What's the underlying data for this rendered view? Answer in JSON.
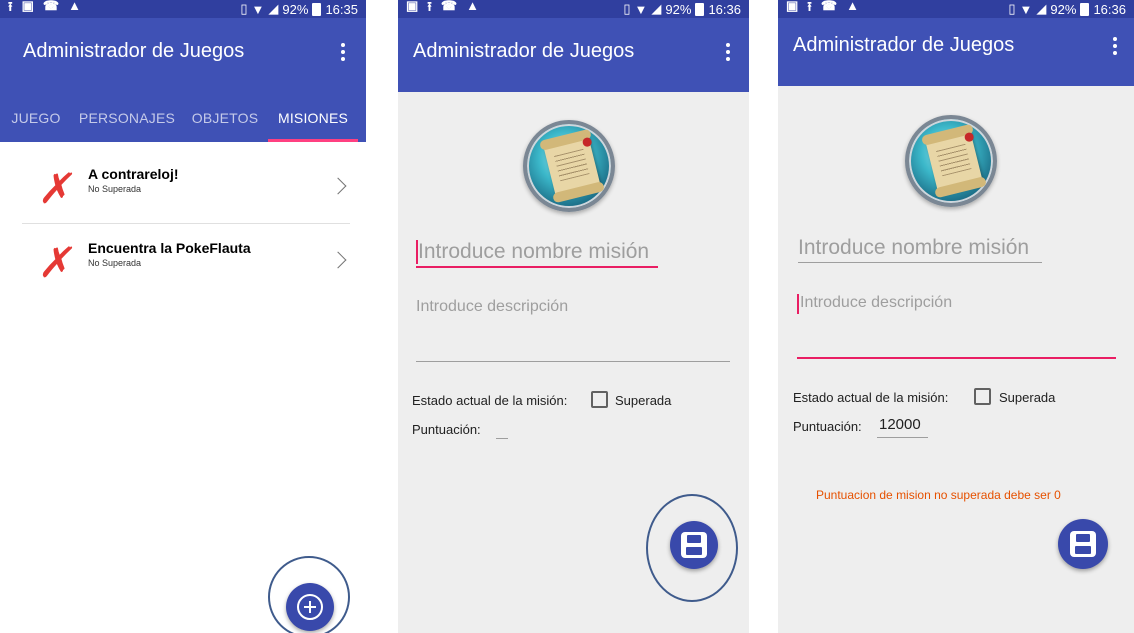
{
  "status_bar": {
    "screen1": {
      "left_icons": [
        "upload-icon",
        "image-icon",
        "missed-call-icon",
        "warning-icon"
      ],
      "battery": "92%",
      "time": "16:35"
    },
    "screen2": {
      "left_icons": [
        "image-icon",
        "upload-icon",
        "missed-call-icon",
        "warning-icon"
      ],
      "battery": "92%",
      "time": "16:36"
    },
    "screen3": {
      "left_icons": [
        "image-icon",
        "upload-icon",
        "missed-call-icon",
        "warning-icon"
      ],
      "battery": "92%",
      "time": "16:36"
    }
  },
  "app": {
    "title": "Administrador de Juegos"
  },
  "tabs": [
    {
      "label": "JUEGO",
      "active": false
    },
    {
      "label": "PERSONAJES",
      "active": false
    },
    {
      "label": "OBJETOS",
      "active": false
    },
    {
      "label": "MISIONES",
      "active": true
    }
  ],
  "missions": [
    {
      "name": "A contrareloj!",
      "status": "No Superada"
    },
    {
      "name": "Encuentra la PokeFlauta",
      "status": "No Superada"
    }
  ],
  "form": {
    "name_placeholder": "Introduce nombre misión",
    "desc_placeholder": "Introduce descripción",
    "state_label": "Estado actual de la misión:",
    "checkbox_label": "Superada",
    "score_label": "Puntuación:",
    "score_value_screen3": "12000",
    "error_message": "Puntuacion de mision no superada debe ser 0"
  },
  "colors": {
    "primary": "#3f51b5",
    "primary_dark": "#303f9f",
    "accent": "#ff4081",
    "fab": "#3949ab",
    "error": "#e65100",
    "cross": "#e53935"
  }
}
